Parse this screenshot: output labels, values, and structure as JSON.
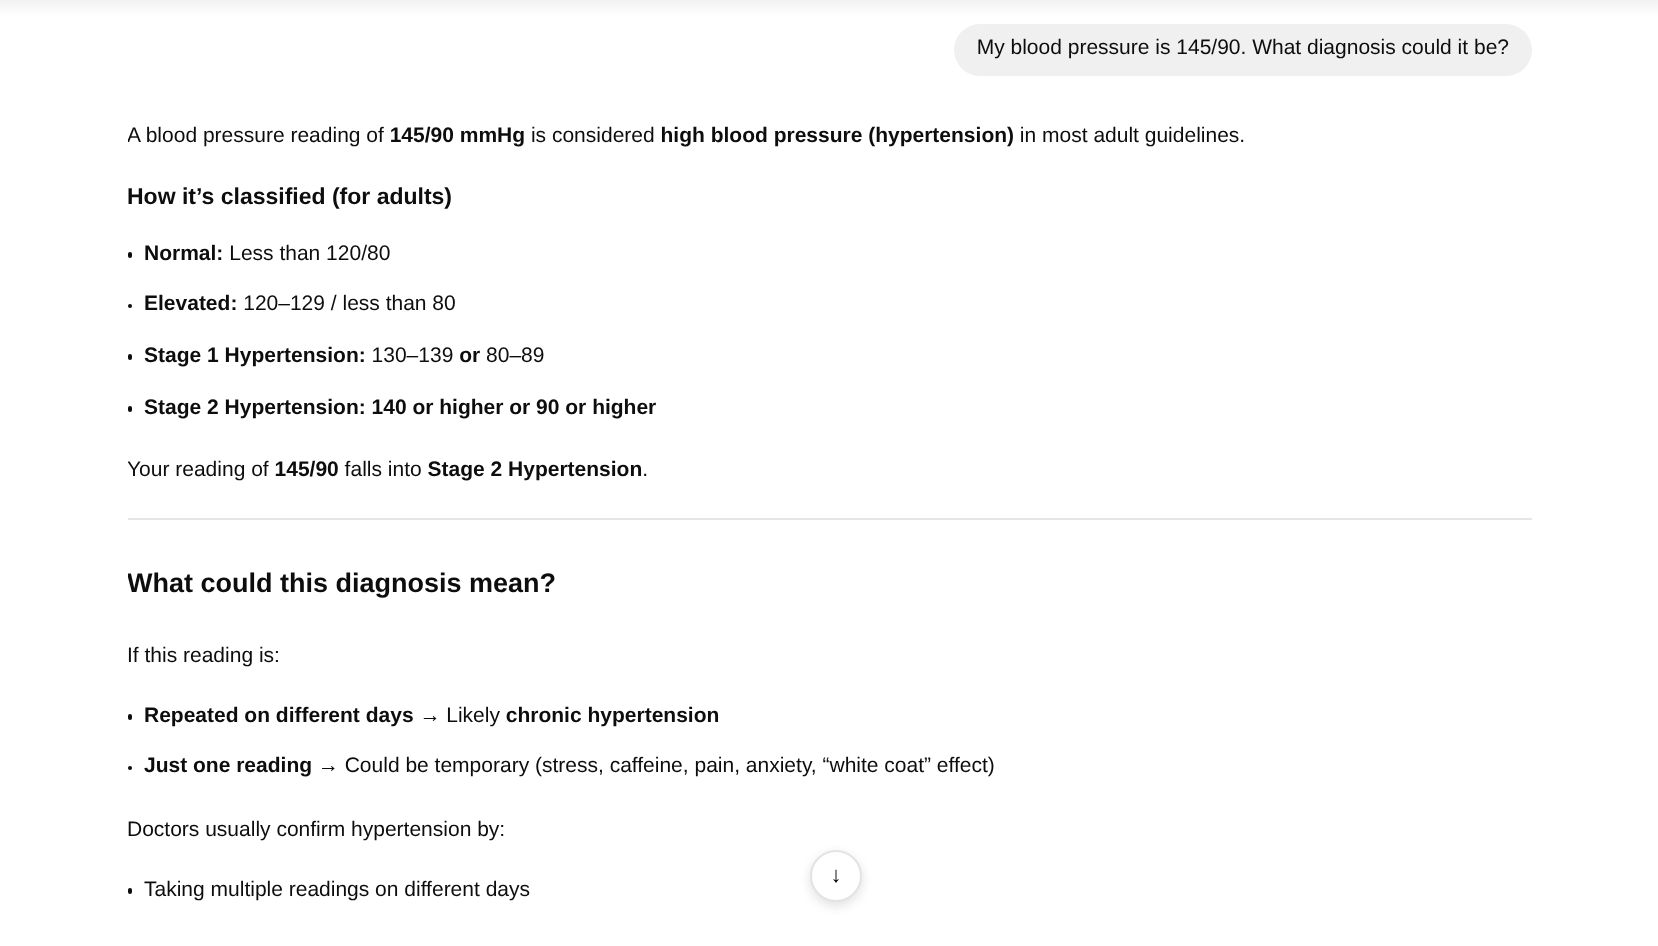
{
  "user_message": "My blood pressure is 145/90. What diagnosis could it be?",
  "answer": [
    {
      "kind": "paragraph",
      "text": "A blood pressure reading of **145/90 mmHg** is considered **high blood pressure (hypertension)** in most adult guidelines."
    },
    {
      "kind": "subheading",
      "text": "How it’s classified (for adults)"
    },
    {
      "kind": "list",
      "items": [
        "**Normal:** Less than 120/80",
        "**Elevated:** 120–129 / less than 80",
        "**Stage 1 Hypertension:** 130–139 **or** 80–89",
        "**Stage 2 Hypertension: 140 or higher or 90 or higher**"
      ]
    },
    {
      "kind": "paragraph",
      "text": "Your reading of **145/90** falls into **Stage 2 Hypertension**."
    },
    {
      "kind": "divider"
    },
    {
      "kind": "heading",
      "text": "What could this diagnosis mean?"
    },
    {
      "kind": "paragraph",
      "text": "If this reading is:"
    },
    {
      "kind": "list",
      "items": [
        "**Repeated on different days** → Likely **chronic hypertension**",
        "**Just one reading** → Could be temporary (stress, caffeine, pain, anxiety, “white coat” effect)"
      ]
    },
    {
      "kind": "paragraph",
      "text": "Doctors usually confirm hypertension by:"
    },
    {
      "kind": "list",
      "items": [
        "Taking multiple readings on different days"
      ]
    }
  ],
  "scroll_down_button": "↓"
}
